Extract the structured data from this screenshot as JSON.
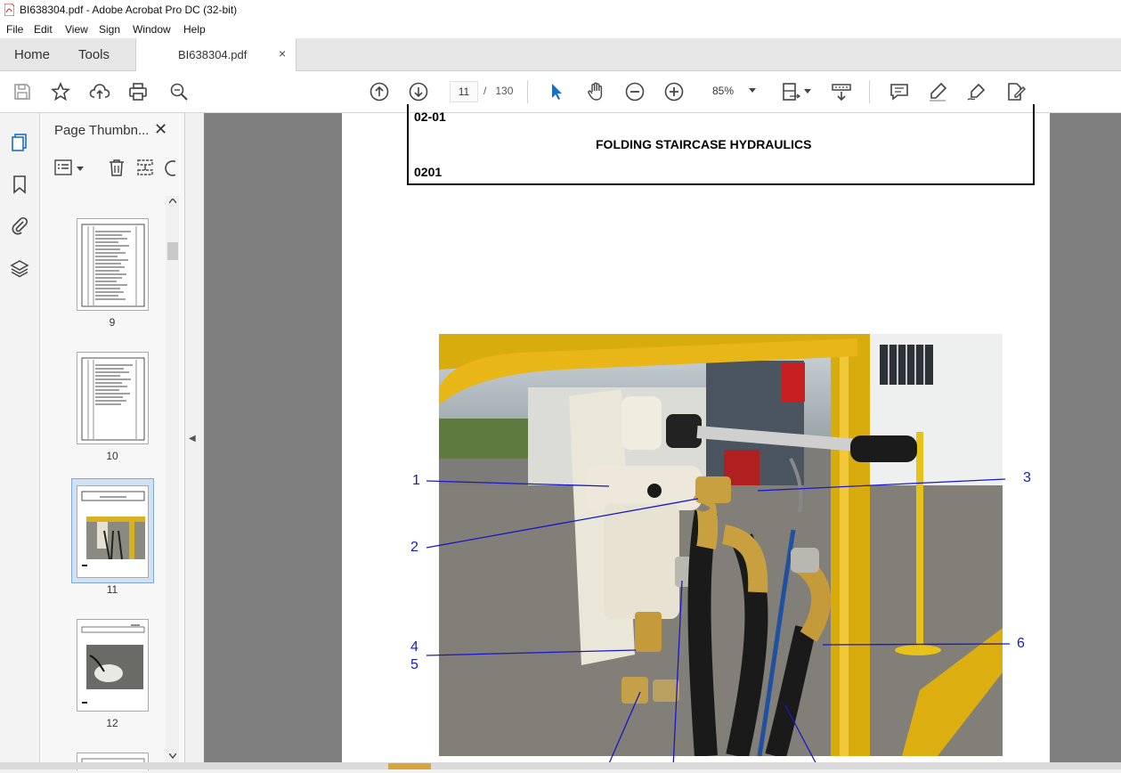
{
  "window": {
    "title": "BI638304.pdf - Adobe Acrobat Pro DC (32-bit)"
  },
  "menu": [
    "File",
    "Edit",
    "View",
    "Sign",
    "Window",
    "Help"
  ],
  "tabs": {
    "home": "Home",
    "tools": "Tools",
    "document": "BI638304.pdf",
    "close": "×"
  },
  "toolbar": {
    "current_page": "11",
    "page_separator": "/",
    "total_pages": "130",
    "zoom": "85%"
  },
  "thumbnails": {
    "title": "Page Thumbn...",
    "close": "✕",
    "pages": [
      {
        "number": "9"
      },
      {
        "number": "10"
      },
      {
        "number": "11",
        "selected": true
      },
      {
        "number": "12"
      }
    ]
  },
  "document": {
    "section_code": "02-01",
    "heading": "FOLDING STAIRCASE HYDRAULICS",
    "doc_code": "0201",
    "callouts": [
      "1",
      "2",
      "3",
      "4",
      "5",
      "6"
    ]
  },
  "colors": {
    "callout": "#1818c8",
    "accent_blue": "#1a6fc4",
    "pdf_red": "#d42020"
  }
}
